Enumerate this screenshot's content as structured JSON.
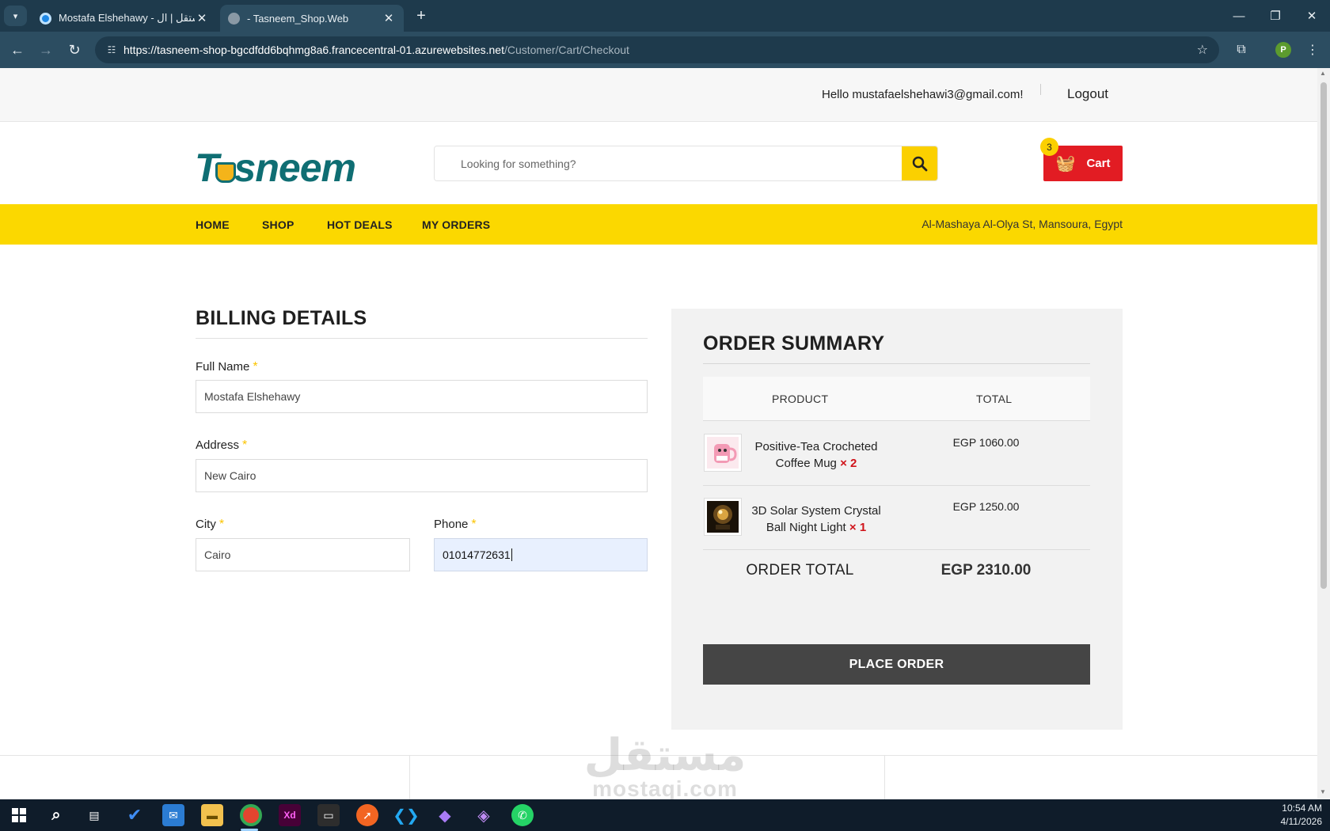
{
  "browser": {
    "tabs": [
      {
        "title": "Mostafa Elshehawy - مستقل | ال",
        "active": false
      },
      {
        "title": "- Tasneem_Shop.Web",
        "active": true
      }
    ],
    "url_host": "https://tasneem-shop-bgcdfdd6bqhmg8a6.francecentral-01.azurewebsites.net",
    "url_path": "/Customer/Cart/Checkout",
    "profile_initial": "P"
  },
  "topbar": {
    "greeting": "Hello mustafaelshehawi3@gmail.com!",
    "logout_label": "Logout"
  },
  "header": {
    "logo_prefix": "T",
    "logo_suffix": "sneem",
    "search_placeholder": "Looking for something?",
    "cart_label": "Cart",
    "cart_count": "3"
  },
  "nav": {
    "items": [
      "HOME",
      "SHOP",
      "HOT DEALS",
      "MY ORDERS"
    ],
    "address": "Al-Mashaya Al-Olya St, Mansoura, Egypt"
  },
  "billing": {
    "title": "BILLING DETAILS",
    "required_mark": "*",
    "full_name_label": "Full Name",
    "full_name_value": "Mostafa Elshehawy",
    "address_label": "Address",
    "address_value": "New Cairo",
    "city_label": "City",
    "city_value": "Cairo",
    "phone_label": "Phone",
    "phone_value": "01014772631"
  },
  "summary": {
    "title": "ORDER SUMMARY",
    "col_product": "PRODUCT",
    "col_total": "TOTAL",
    "items": [
      {
        "name": "Positive-Tea Crocheted Coffee Mug",
        "qty": "× 2",
        "total": "EGP 1060.00"
      },
      {
        "name": "3D Solar System Crystal Ball Night Light",
        "qty": "× 1",
        "total": "EGP 1250.00"
      }
    ],
    "order_total_label": "ORDER TOTAL",
    "order_total_value": "EGP 2310.00",
    "place_order_label": "PLACE ORDER"
  },
  "watermark": {
    "arabic": "مستقل",
    "latin": "mostaqi.com"
  },
  "clock": {
    "time": "10:54 AM",
    "date": "4/11/2026"
  },
  "colors": {
    "brand_teal": "#0f6e73",
    "nav_yellow": "#fbd800",
    "cart_red": "#e21c23",
    "button_dark": "#454545"
  }
}
